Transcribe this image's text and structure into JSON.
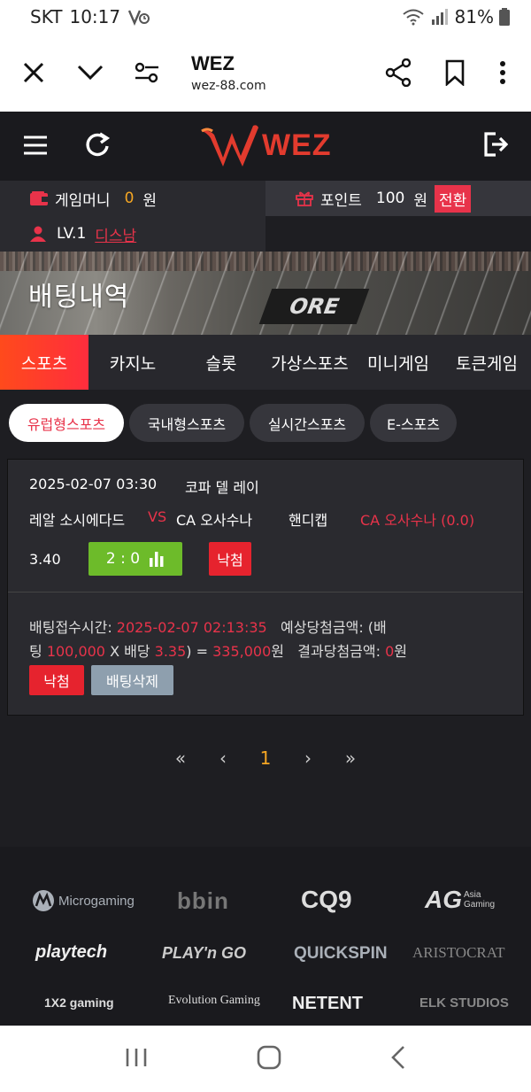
{
  "status_bar": {
    "carrier": "SKT",
    "time": "10:17",
    "battery": "81%"
  },
  "browser": {
    "site_name": "WEZ",
    "url": "wez-88.com"
  },
  "header": {
    "logo_text": "WEZ"
  },
  "account": {
    "game_money_label": "게임머니",
    "game_money_value": "0",
    "game_money_unit": "원",
    "points_label": "포인트",
    "points_value": "100",
    "points_unit": "원",
    "convert_label": "전환",
    "level": "LV.1",
    "username": "디스남"
  },
  "banner": {
    "title": "배팅내역",
    "sign_text": "ORE"
  },
  "category_tabs": [
    {
      "label": "스포츠",
      "active": true
    },
    {
      "label": "카지노",
      "active": false
    },
    {
      "label": "슬롯",
      "active": false
    },
    {
      "label": "가상스포츠",
      "active": false
    },
    {
      "label": "미니게임",
      "active": false
    },
    {
      "label": "토큰게임",
      "active": false
    }
  ],
  "sub_tabs": [
    {
      "label": "유럽형스포츠",
      "active": true
    },
    {
      "label": "국내형스포츠",
      "active": false
    },
    {
      "label": "실시간스포츠",
      "active": false
    },
    {
      "label": "E-스포츠",
      "active": false
    }
  ],
  "bet": {
    "datetime": "2025-02-07 03:30",
    "league": "코파 델 레이",
    "home": "레알 소시에다드",
    "vs": "VS",
    "away": "CA 오사수나",
    "market": "핸디캡",
    "pick": "CA 오사수나 (0.0)",
    "odds": "3.40",
    "score": "2 : 0",
    "result": "낙첨",
    "detail": {
      "accept_time_label": "배팅접수시간: ",
      "accept_time": "2025-02-07 02:13:35",
      "expected_label_1": "예상당첨금액: (배",
      "expected_label_2": "팅 ",
      "stake": "100,000",
      "times_label": " X 배당 ",
      "odds": "3.35",
      "equals_label": ") = ",
      "expected_amount": "335,000",
      "won": "원",
      "result_amount_label": "결과당첨금액: ",
      "result_amount": "0",
      "result_won": "원"
    },
    "result_button": "낙첨",
    "delete_button": "배팅삭제"
  },
  "pagination": {
    "first": "«",
    "prev": "‹",
    "current": "1",
    "next": "›",
    "last": "»"
  },
  "providers": [
    "Microgaming",
    "bbin",
    "CQ9",
    "AG",
    "Asia Gaming",
    "playtech",
    "PLAY'n GO",
    "QUICKSPIN",
    "ARISTOCRAT",
    "1X2 gaming",
    "Evolution Gaming",
    "NETENT",
    "ELK STUDIOS"
  ],
  "colors": {
    "accent_red": "#e8334a",
    "accent_orange": "#f5a623",
    "score_green": "#6dbb2a",
    "tab_gradient_start": "#ff4a1c",
    "tab_gradient_end": "#ff2d3d"
  }
}
